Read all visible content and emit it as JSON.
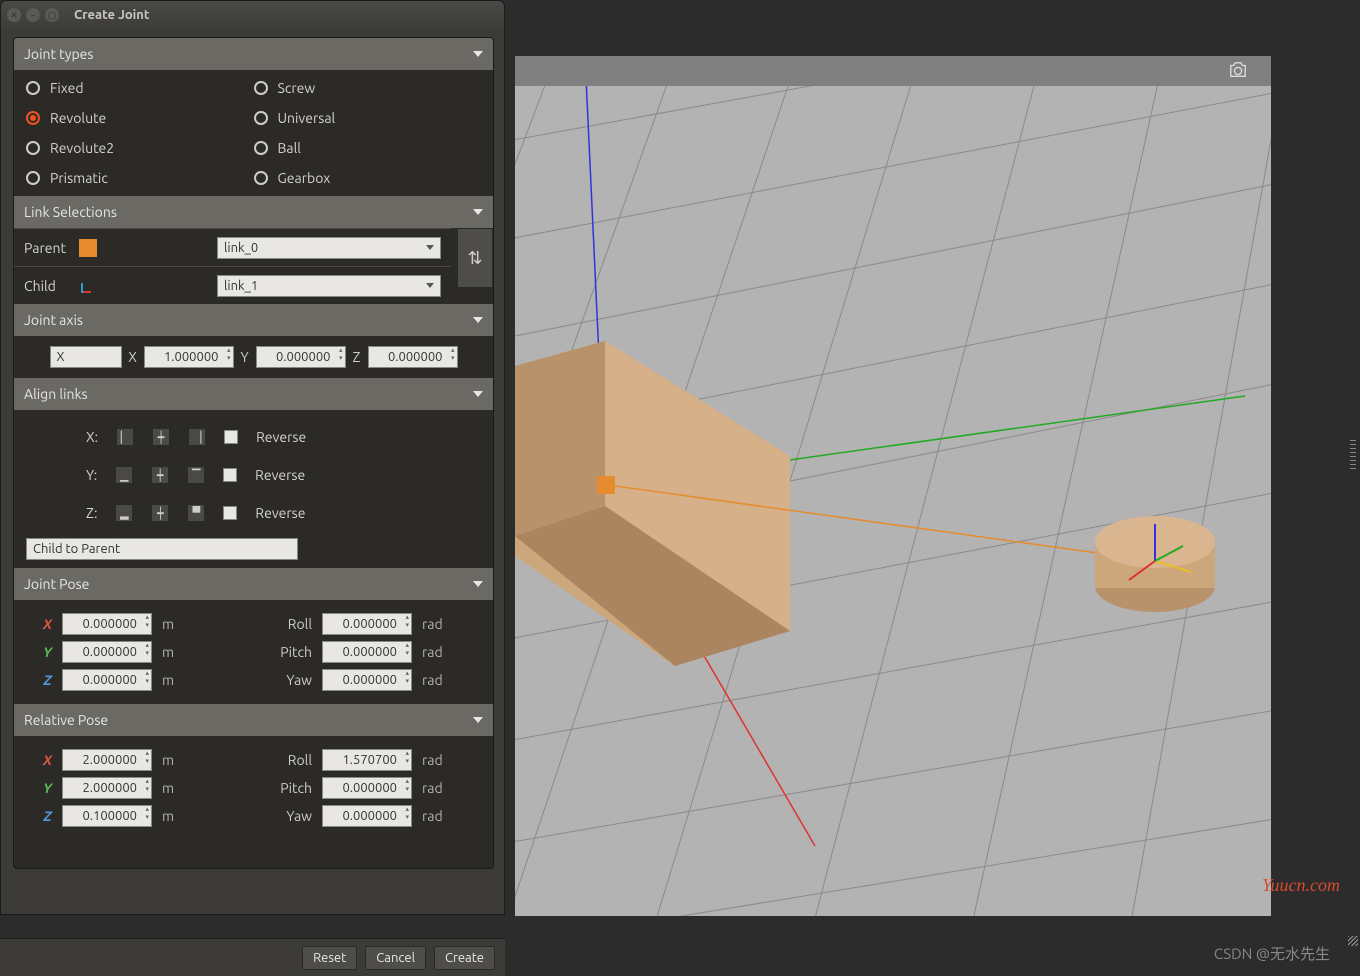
{
  "window": {
    "title": "Create Joint"
  },
  "jointTypes": {
    "header": "Joint types",
    "opts": [
      "Fixed",
      "Revolute",
      "Revolute2",
      "Prismatic",
      "Screw",
      "Universal",
      "Ball",
      "Gearbox"
    ],
    "selected": "Revolute"
  },
  "linkSel": {
    "header": "Link Selections",
    "parentLabel": "Parent",
    "parentValue": "link_0",
    "childLabel": "Child",
    "childValue": "link_1"
  },
  "jointAxis": {
    "header": "Joint axis",
    "axisSel": "X",
    "labels": {
      "x": "X",
      "y": "Y",
      "z": "Z"
    },
    "x": "1.000000",
    "y": "0.000000",
    "z": "0.000000"
  },
  "align": {
    "header": "Align links",
    "rows": {
      "x": "X:",
      "y": "Y:",
      "z": "Z:"
    },
    "reverse": "Reverse",
    "combo": "Child to Parent"
  },
  "jointPose": {
    "header": "Joint Pose",
    "x": "0.000000",
    "y": "0.000000",
    "z": "0.000000",
    "roll": "0.000000",
    "pitch": "0.000000",
    "yaw": "0.000000",
    "rollLbl": "Roll",
    "pitchLbl": "Pitch",
    "yawLbl": "Yaw",
    "mu": "m",
    "ru": "rad"
  },
  "relPose": {
    "header": "Relative Pose",
    "x": "2.000000",
    "y": "2.000000",
    "z": "0.100000",
    "roll": "1.570700",
    "pitch": "0.000000",
    "yaw": "0.000000"
  },
  "buttons": {
    "reset": "Reset",
    "cancel": "Cancel",
    "create": "Create"
  },
  "watermark": "Yuucn.com",
  "csdn": "CSDN @无水先生"
}
